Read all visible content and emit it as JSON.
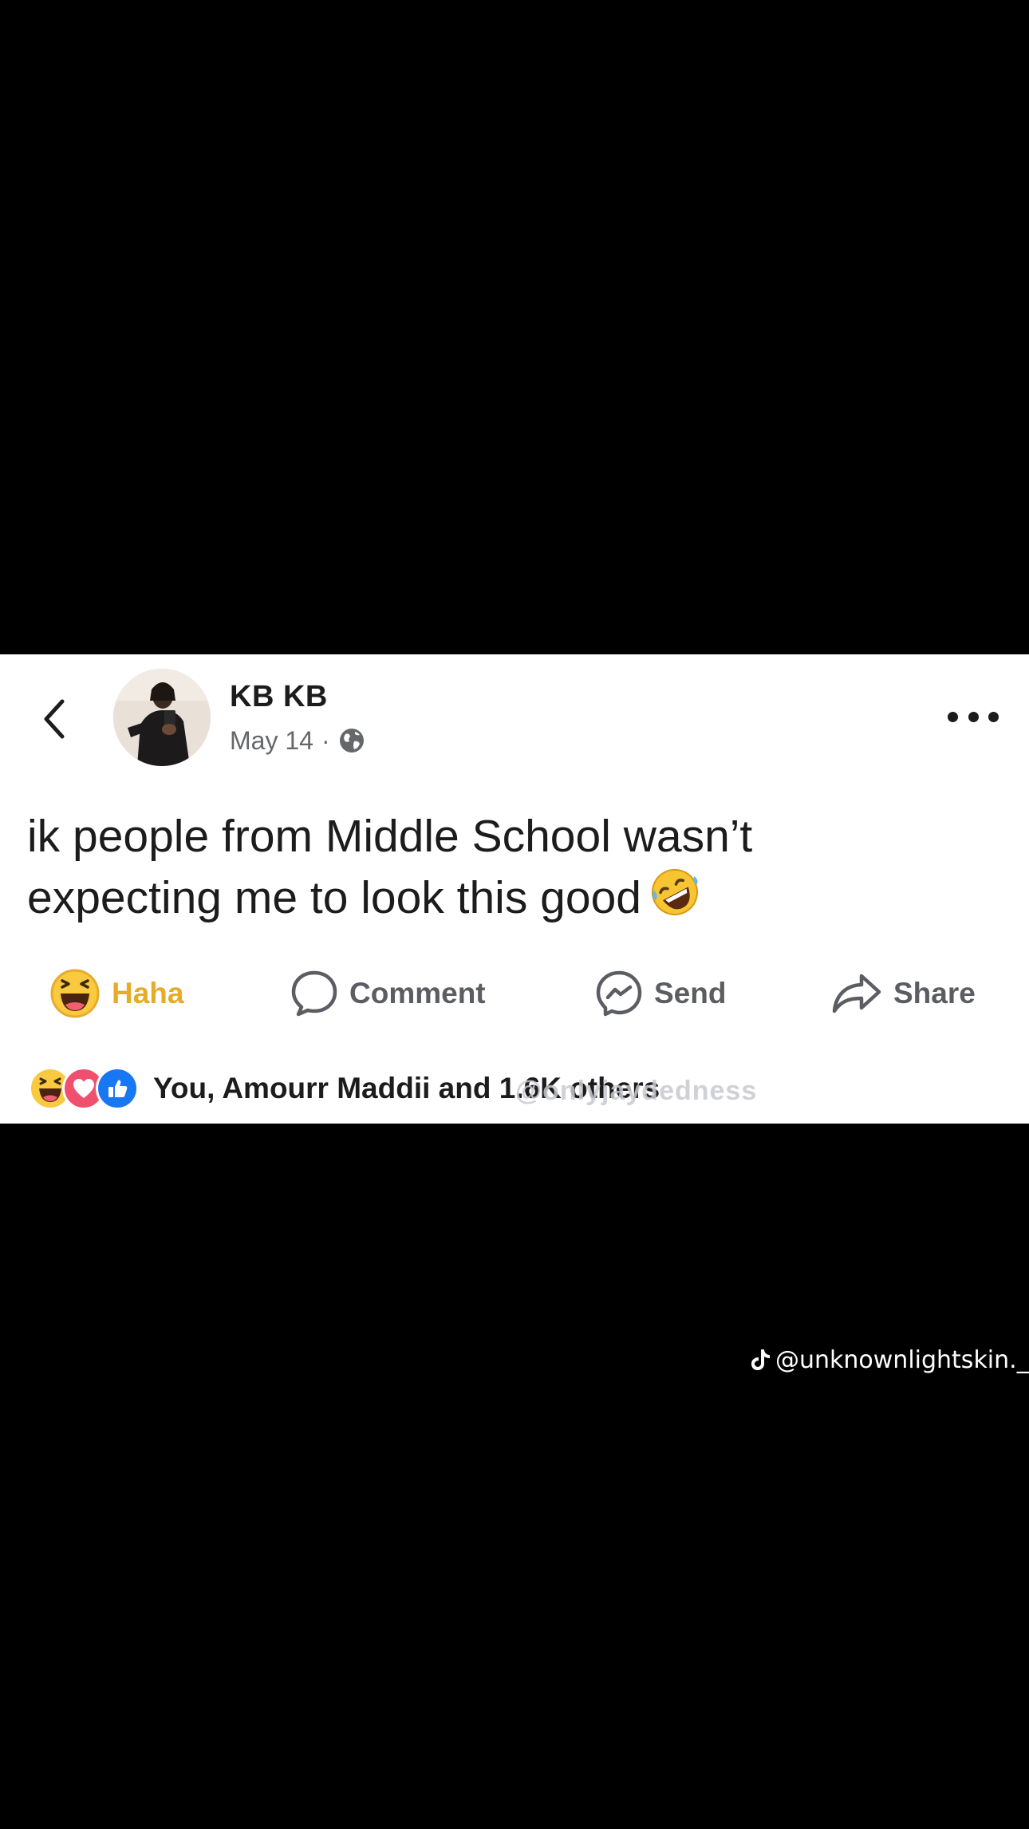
{
  "post": {
    "author_name": "KB KB",
    "date": "May 14",
    "meta_separator": "·",
    "visibility_icon": "globe-icon",
    "text_line_1": "ik people from Middle School wasn’t",
    "text_line_2": "expecting me to look this good"
  },
  "actions": {
    "haha_label": "Haha",
    "comment_label": "Comment",
    "send_label": "Send",
    "share_label": "Share"
  },
  "reactions": {
    "icons": [
      "haha-icon",
      "love-icon",
      "like-icon"
    ],
    "summary": "You, Amourr Maddii and 1.6K others"
  },
  "watermarks": {
    "overlay": "@onlyjaydedness",
    "tiktok": "@unknownlightskin._"
  },
  "colors": {
    "background": "#000000",
    "card": "#ffffff",
    "haha_accent": "#e6ac27",
    "like_blue": "#1877f2",
    "love_red": "#f0506e"
  }
}
